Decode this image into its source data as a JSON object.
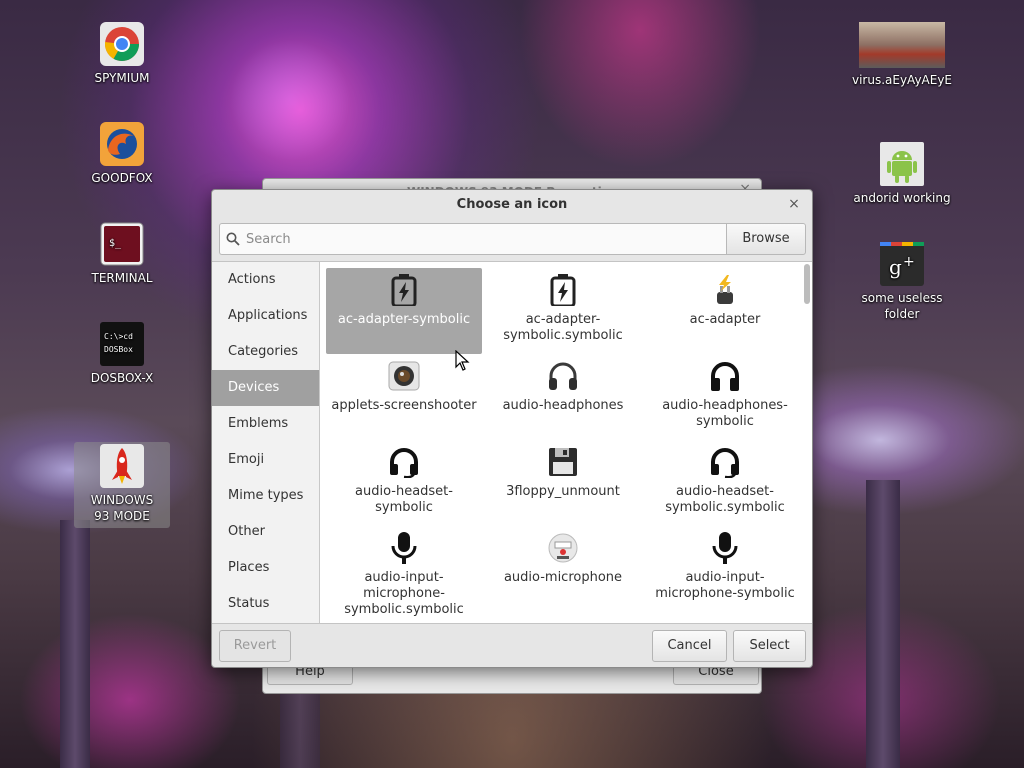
{
  "desktop": {
    "icons_left": [
      {
        "label": "SPYMIUM",
        "icon": "chrome-icon"
      },
      {
        "label": "GOODFOX",
        "icon": "firefox-icon"
      },
      {
        "label": "TERMINAL",
        "icon": "terminal-icon"
      },
      {
        "label": "DOSBOX-X",
        "icon": "dosbox-icon",
        "icon_text": "C:\\>cd\nDOSBox"
      },
      {
        "label": "WINDOWS 93 MODE",
        "icon": "rocket-icon",
        "selected": true
      }
    ],
    "icons_right": [
      {
        "label": "virus.aEyAyAEyE",
        "icon": "image-thumbnail-icon"
      },
      {
        "label": "andorid working",
        "icon": "android-icon"
      },
      {
        "label": "some useless folder",
        "icon": "google-plus-icon",
        "icon_text": "g+"
      }
    ]
  },
  "background_window": {
    "title": "WINDOWS 93 MODE Properties",
    "help_label": "Help",
    "close_label": "Close"
  },
  "dialog": {
    "title": "Choose an icon",
    "search_placeholder": "Search",
    "browse_label": "Browse",
    "categories": [
      "Actions",
      "Applications",
      "Categories",
      "Devices",
      "Emblems",
      "Emoji",
      "Mime types",
      "Other",
      "Places",
      "Status"
    ],
    "active_category": "Devices",
    "icons": [
      {
        "label": "ac-adapter-symbolic",
        "icon": "battery-charging-icon",
        "selected": true
      },
      {
        "label": "ac-adapter-symbolic.symbolic",
        "icon": "battery-charging-icon"
      },
      {
        "label": "ac-adapter",
        "icon": "power-plug-icon"
      },
      {
        "label": "applets-screenshooter",
        "icon": "camera-icon"
      },
      {
        "label": "audio-headphones",
        "icon": "headphones-icon"
      },
      {
        "label": "audio-headphones-symbolic",
        "icon": "headphones-icon"
      },
      {
        "label": "audio-headset-symbolic",
        "icon": "headset-icon"
      },
      {
        "label": "3floppy_unmount",
        "icon": "floppy-icon"
      },
      {
        "label": "audio-headset-symbolic.symbolic",
        "icon": "headset-icon"
      },
      {
        "label": "audio-input-microphone-symbolic.symbolic",
        "icon": "microphone-icon"
      },
      {
        "label": "audio-microphone",
        "icon": "microphone-device-icon"
      },
      {
        "label": "audio-input-microphone-symbolic",
        "icon": "microphone-icon"
      }
    ],
    "revert_label": "Revert",
    "cancel_label": "Cancel",
    "select_label": "Select"
  }
}
